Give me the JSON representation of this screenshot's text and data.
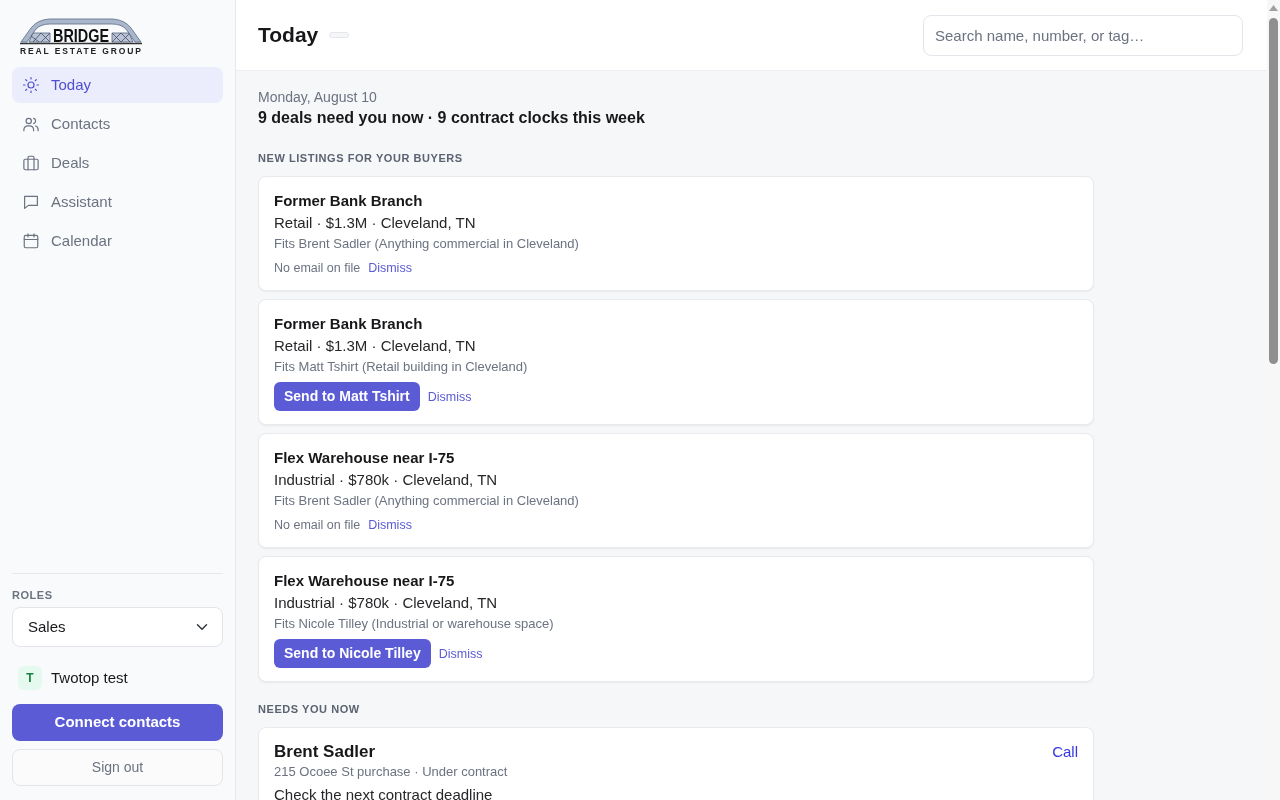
{
  "sidebar": {
    "logo": {
      "wordmark": "BRIDGE",
      "tagline": "REAL ESTATE GROUP"
    },
    "nav": [
      {
        "label": "Today",
        "selected": true
      },
      {
        "label": "Contacts",
        "selected": false
      },
      {
        "label": "Deals",
        "selected": false
      },
      {
        "label": "Assistant",
        "selected": false
      },
      {
        "label": "Calendar",
        "selected": false
      }
    ],
    "roles": {
      "label": "ROLES",
      "value": "Sales"
    },
    "user": {
      "initial": "T",
      "name": "Twotop test"
    },
    "connect_button": "Connect contacts",
    "sign_out_button": "Sign out"
  },
  "header": {
    "title": "Today",
    "search": {
      "placeholder": "Search name, number, or tag…"
    }
  },
  "summary": {
    "date": "Monday, August 10",
    "headline": "9 deals need you now · 9 contract clocks this week"
  },
  "sections": [
    {
      "kind": "listings",
      "title": "NEW LISTINGS FOR YOUR BUYERS",
      "items": [
        {
          "kind": "no-email",
          "title": "Former Bank Branch",
          "details": "Retail · $1.3M · Cleveland, TN",
          "fit": "Fits Brent Sadler (Anything commercial in Cleveland)",
          "note": "No email on file",
          "dismiss": "Dismiss"
        },
        {
          "kind": "send",
          "title": "Former Bank Branch",
          "details": "Retail · $1.3M · Cleveland, TN",
          "fit": "Fits Matt Tshirt (Retail building in Cleveland)",
          "send": "Send to Matt Tshirt",
          "dismiss": "Dismiss"
        },
        {
          "kind": "no-email",
          "title": "Flex Warehouse near I-75",
          "details": "Industrial · $780k · Cleveland, TN",
          "fit": "Fits Brent Sadler (Anything commercial in Cleveland)",
          "note": "No email on file",
          "dismiss": "Dismiss"
        },
        {
          "kind": "send",
          "title": "Flex Warehouse near I-75",
          "details": "Industrial · $780k · Cleveland, TN",
          "fit": "Fits Nicole Tilley (Industrial or warehouse space)",
          "send": "Send to Nicole Tilley",
          "dismiss": "Dismiss"
        }
      ]
    },
    {
      "kind": "needs",
      "title": "NEEDS YOU NOW",
      "items": [
        {
          "name": "Brent Sadler",
          "subtitle": "215 Ocoee St purchase · Under contract",
          "task": "Check the next contract deadline",
          "action": "Call"
        }
      ]
    }
  ]
}
